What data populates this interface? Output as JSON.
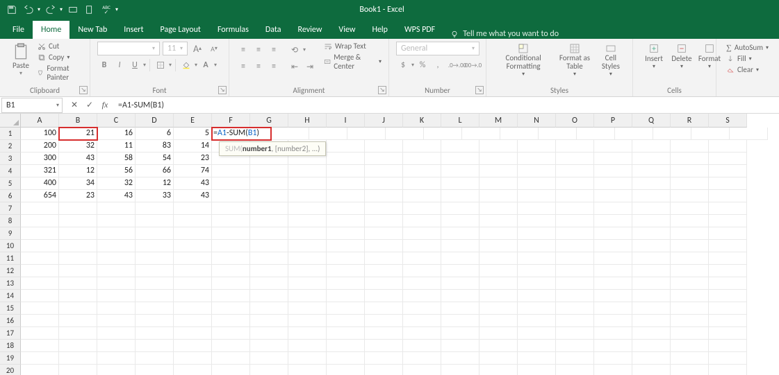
{
  "title": "Book1 - Excel",
  "qat": {
    "tooltip_save": "Save",
    "tooltip_undo": "Undo",
    "tooltip_redo": "Redo"
  },
  "tabs": [
    "File",
    "Home",
    "New Tab",
    "Insert",
    "Page Layout",
    "Formulas",
    "Data",
    "Review",
    "View",
    "Help",
    "WPS PDF"
  ],
  "active_tab_index": 1,
  "tell_me_placeholder": "Tell me what you want to do",
  "ribbon": {
    "clipboard": {
      "paste": "Paste",
      "cut": "Cut",
      "copy": "Copy",
      "format_painter": "Format Painter",
      "label": "Clipboard"
    },
    "font": {
      "font_name": "",
      "font_size": "11",
      "label": "Font",
      "bold": "B",
      "italic": "I",
      "underline": "U",
      "grow": "A",
      "shrink": "A"
    },
    "alignment": {
      "wrap": "Wrap Text",
      "merge": "Merge & Center",
      "label": "Alignment"
    },
    "number": {
      "format": "General",
      "label": "Number",
      "percent": "%",
      "comma": ",",
      "currency": "$"
    },
    "styles": {
      "cond": "Conditional Formatting",
      "fat": "Format as Table",
      "cell": "Cell Styles",
      "label": "Styles"
    },
    "cells": {
      "insert": "Insert",
      "delete": "Delete",
      "format": "Format",
      "label": "Cells"
    },
    "editing": {
      "autosum": "AutoSum",
      "fill": "Fill",
      "clear": "Clear"
    }
  },
  "name_box": "B1",
  "formula_bar": "=A1-SUM(B1)",
  "columns": [
    "A",
    "B",
    "C",
    "D",
    "E",
    "F",
    "G",
    "H",
    "I",
    "J",
    "K",
    "L",
    "M",
    "N",
    "O",
    "P",
    "Q",
    "R",
    "S"
  ],
  "row_count_shown": 20,
  "cell_data": [
    {
      "r": 1,
      "c": "A",
      "v": "100"
    },
    {
      "r": 1,
      "c": "B",
      "v": "21"
    },
    {
      "r": 1,
      "c": "C",
      "v": "16"
    },
    {
      "r": 1,
      "c": "D",
      "v": "6"
    },
    {
      "r": 1,
      "c": "E",
      "v": "5"
    },
    {
      "r": 2,
      "c": "A",
      "v": "200"
    },
    {
      "r": 2,
      "c": "B",
      "v": "32"
    },
    {
      "r": 2,
      "c": "C",
      "v": "11"
    },
    {
      "r": 2,
      "c": "D",
      "v": "83"
    },
    {
      "r": 2,
      "c": "E",
      "v": "14"
    },
    {
      "r": 3,
      "c": "A",
      "v": "300"
    },
    {
      "r": 3,
      "c": "B",
      "v": "43"
    },
    {
      "r": 3,
      "c": "C",
      "v": "58"
    },
    {
      "r": 3,
      "c": "D",
      "v": "54"
    },
    {
      "r": 3,
      "c": "E",
      "v": "23"
    },
    {
      "r": 4,
      "c": "A",
      "v": "321"
    },
    {
      "r": 4,
      "c": "B",
      "v": "12"
    },
    {
      "r": 4,
      "c": "C",
      "v": "56"
    },
    {
      "r": 4,
      "c": "D",
      "v": "66"
    },
    {
      "r": 4,
      "c": "E",
      "v": "74"
    },
    {
      "r": 5,
      "c": "A",
      "v": "400"
    },
    {
      "r": 5,
      "c": "B",
      "v": "34"
    },
    {
      "r": 5,
      "c": "C",
      "v": "32"
    },
    {
      "r": 5,
      "c": "D",
      "v": "12"
    },
    {
      "r": 5,
      "c": "E",
      "v": "43"
    },
    {
      "r": 6,
      "c": "A",
      "v": "654"
    },
    {
      "r": 6,
      "c": "B",
      "v": "23"
    },
    {
      "r": 6,
      "c": "C",
      "v": "43"
    },
    {
      "r": 6,
      "c": "D",
      "v": "33"
    },
    {
      "r": 6,
      "c": "E",
      "v": "43"
    }
  ],
  "active_formula_cell": {
    "r": 1,
    "c": "F",
    "display": "=A1-SUM(B1)"
  },
  "highlighted_cell": {
    "r": 1,
    "c": "B"
  },
  "tooltip": {
    "label": "SUM(",
    "bold": "number1",
    "rest": ", [number2], ...)",
    "row": 2,
    "col": "F"
  },
  "colors": {
    "brand": "#0e6b3e",
    "highlight_red": "#d62d2d",
    "blue_ref": "#0a63c7"
  }
}
